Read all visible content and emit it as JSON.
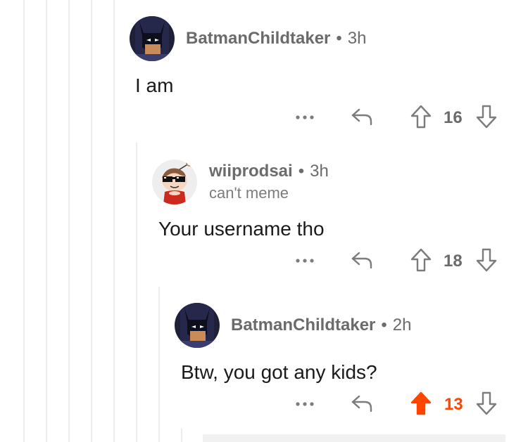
{
  "comments": [
    {
      "author": "BatmanChildtaker",
      "separator": "•",
      "age": "3h",
      "flair": "",
      "body": "I am",
      "score": "16",
      "upvoted": false,
      "avatar_icon": "batman-avatar-icon"
    },
    {
      "author": "wiiprodsai",
      "separator": "•",
      "age": "3h",
      "flair": "can't meme",
      "body": "Your username tho",
      "score": "18",
      "upvoted": false,
      "avatar_icon": "snoo-sunglasses-avatar-icon"
    },
    {
      "author": "BatmanChildtaker",
      "separator": "•",
      "age": "2h",
      "flair": "",
      "body": "Btw, you got any kids?",
      "score": "13",
      "upvoted": true,
      "avatar_icon": "batman-avatar-icon"
    }
  ],
  "icons": {
    "more": "more-options-icon",
    "reply": "reply-arrow-icon",
    "upvote": "upvote-arrow-icon",
    "downvote": "downvote-arrow-icon"
  },
  "colors": {
    "upvote_active": "#ff4500",
    "meta_gray": "#6b6b6b",
    "thread_line": "#ececec"
  }
}
